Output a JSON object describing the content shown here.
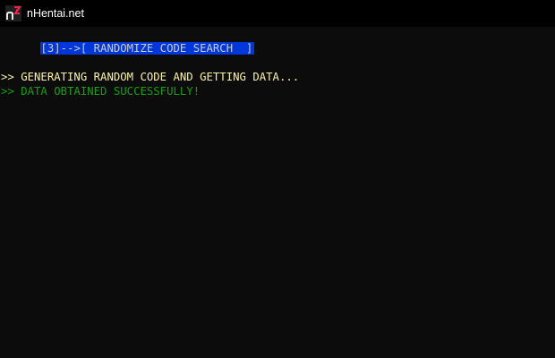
{
  "window": {
    "title": "nHentai.net",
    "icon": "nhentai-logo-icon",
    "colors": {
      "titlebar_bg": "#000000",
      "console_bg": "#0c0c0c",
      "highlight_bg": "#0037da",
      "yellow_text": "#f9f1a5",
      "green_text": "#13a10e",
      "logo_pink": "#ed2553"
    }
  },
  "console": {
    "menu_line": "[3]-->[ RANDOMIZE CODE SEARCH  ]",
    "status_line_1": ">> GENERATING RANDOM CODE AND GETTING DATA...",
    "status_line_2": ">> DATA OBTAINED SUCCESSFULLY!"
  }
}
